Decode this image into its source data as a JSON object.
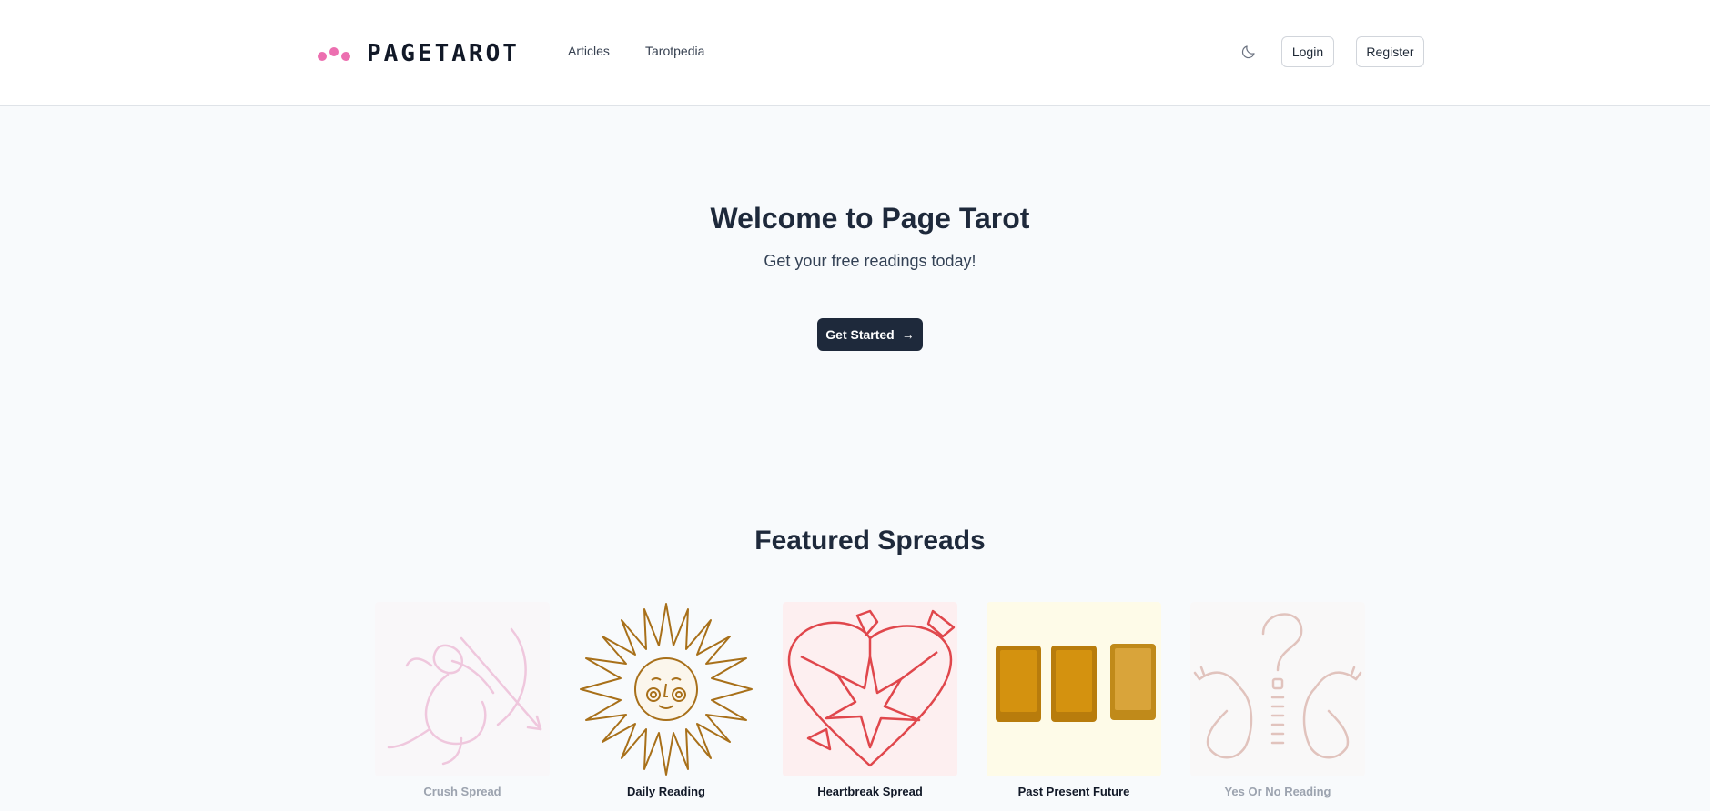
{
  "brand": {
    "name": "PAGETAROT",
    "dot_color": "#ec6fb0"
  },
  "nav": {
    "items": [
      "Articles",
      "Tarotpedia"
    ]
  },
  "header_actions": {
    "theme_icon": "moon-icon",
    "login": "Login",
    "register": "Register"
  },
  "hero": {
    "title": "Welcome to Page Tarot",
    "subtitle": "Get your free readings today!",
    "cta": "Get Started",
    "cta_icon": "→"
  },
  "featured": {
    "title": "Featured Spreads",
    "spreads": [
      {
        "label": "Crush Spread",
        "icon": "cupid-icon"
      },
      {
        "label": "Daily Reading",
        "icon": "sun-icon"
      },
      {
        "label": "Heartbreak Spread",
        "icon": "broken-heart-icon"
      },
      {
        "label": "Past Present Future",
        "icon": "three-cards-icon"
      },
      {
        "label": "Yes Or No Reading",
        "icon": "question-hands-icon"
      }
    ]
  },
  "colors": {
    "dark": "#1e293b",
    "pink": "#ec6fb0",
    "gold": "#c9890f",
    "red": "#e0474c",
    "sun": "#a8701a",
    "tan": "#c9907f"
  }
}
